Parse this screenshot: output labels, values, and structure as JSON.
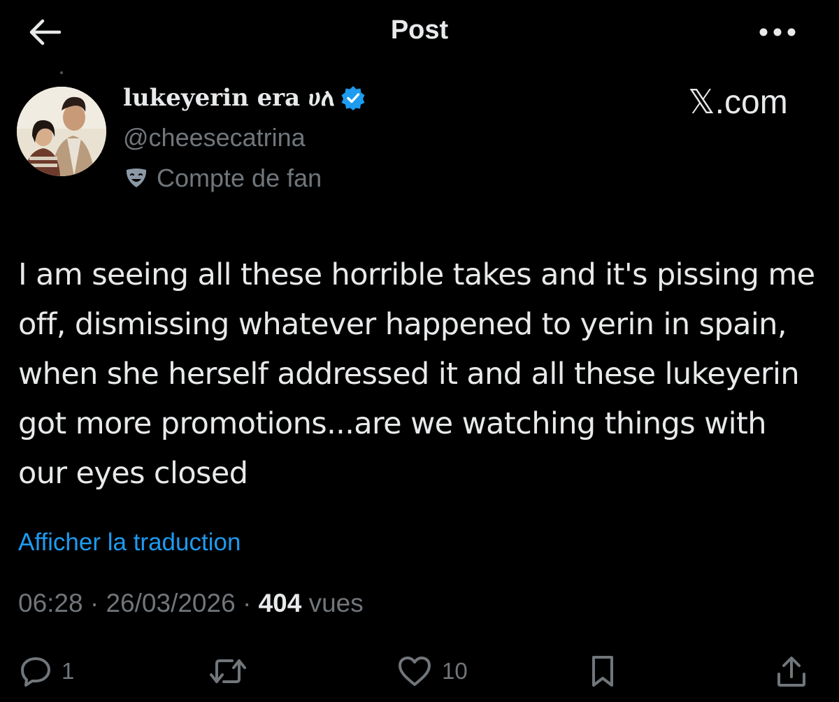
{
  "header": {
    "title": "Post"
  },
  "author": {
    "display_name": "lukeyerin era ሀለ",
    "handle": "@cheesecatrina",
    "label_text": "Compte de fan",
    "verified": true
  },
  "watermark": "𝕏.com",
  "tweet": {
    "text": "I am seeing all these horrible takes and it's pissing me off, dismissing whatever happened to yerin in spain, when she herself addressed it and all these lukeyerin got more promotions...are we watching things with our eyes closed",
    "translate_label": "Afficher la traduction",
    "time": "06:28",
    "date": "26/03/2026",
    "separator": "·",
    "views_count": "404",
    "views_label": "vues"
  },
  "actions": {
    "replies": "1",
    "likes": "10"
  },
  "colors": {
    "background": "#000000",
    "text": "#e7e9ea",
    "muted": "#71767b",
    "link": "#1d9bf0",
    "verified": "#1d9bf0"
  }
}
